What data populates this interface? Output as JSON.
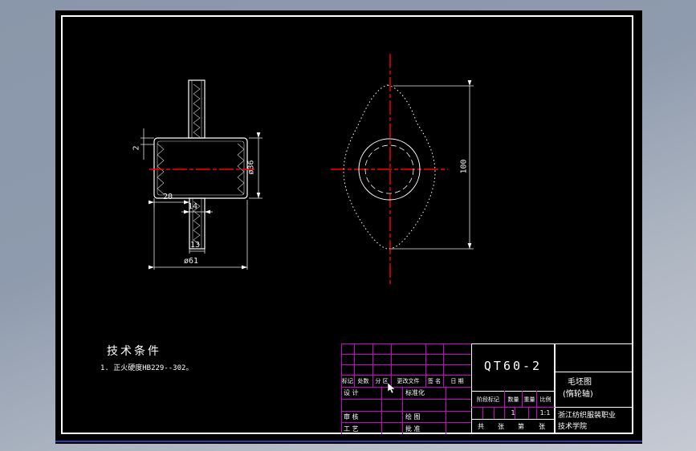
{
  "colors": {
    "canvas_bg": "#000000",
    "line": "#ffffff",
    "centerline": "#ff0000",
    "table_grid": "#cf00cf",
    "bottom_edge": "#2a3db0",
    "app_bg_top": "#8a97aa",
    "app_bg_bottom": "#c5cad3"
  },
  "front_view": {
    "dim_step": "2",
    "dim_hub_offset": "20",
    "dim_shaft": "14",
    "dim_bore": "13",
    "dim_flange_dia": "ø61",
    "dim_hub_dia": "ø36"
  },
  "side_view": {
    "dim_height": "100"
  },
  "notes": {
    "title": "技术条件",
    "line1": "1. 正火硬度HB229--302。"
  },
  "title_block": {
    "code": "QT60-2",
    "name_line1": "毛坯图",
    "name_line2": "(惰轮轴)",
    "org_line1": "浙江纺织服装职业",
    "org_line2": "技术学院",
    "rev_headers": [
      "标记",
      "处数",
      "分 区",
      "更改文件",
      "签 名",
      "日 期"
    ],
    "design": "设 计",
    "standardization": "标准化",
    "review": "审 核",
    "draw": "绘 图",
    "process": "工 艺",
    "approve": "批 准",
    "stage_label": "阶段标记",
    "qty_label": "数量",
    "mass_label": "重量",
    "scale_label": "比例",
    "qty_value": "1",
    "scale_value": "1:1",
    "sheet": [
      "共",
      "张",
      "第",
      "张"
    ]
  }
}
